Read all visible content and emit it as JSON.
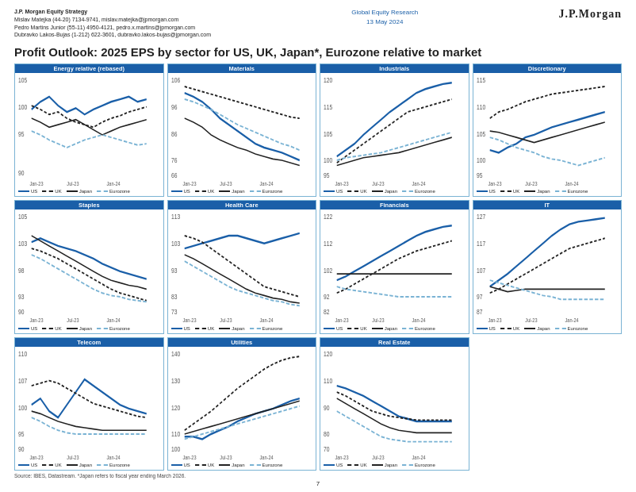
{
  "header": {
    "firm": "J.P. Morgan Equity Strategy",
    "authors": "Mislav Matejka (44-20) 7134-9741, mislav.matejka@jpmorgan.com\nPedro Martins Junior (55-11) 4950-4121, pedro.x.martins@jpmorgan.com\nDubravko Lakos-Bujas (1-212) 622-3601, dubravko.lakos-bujas@jpmorgan.com",
    "division": "Global Equity Research",
    "date": "13 May 2024",
    "logo": "J.P.Morgan"
  },
  "main_title": "Profit Outlook: 2025 EPS by sector for US, UK, Japan*, Eurozone relative to market",
  "charts": [
    {
      "title": "Energy relative (rebased)",
      "ymin": 90,
      "ymax": 105
    },
    {
      "title": "Materials",
      "ymin": 66,
      "ymax": 106
    },
    {
      "title": "Industrials",
      "ymin": 95,
      "ymax": 120
    },
    {
      "title": "Discretionary",
      "ymin": 95,
      "ymax": 115
    },
    {
      "title": "Staples",
      "ymin": 90,
      "ymax": 105
    },
    {
      "title": "Health Care",
      "ymin": 73,
      "ymax": 113
    },
    {
      "title": "Financials",
      "ymin": 82,
      "ymax": 122
    },
    {
      "title": "IT",
      "ymin": 87,
      "ymax": 127
    },
    {
      "title": "Telecom",
      "ymin": 90,
      "ymax": 110
    },
    {
      "title": "Utilities",
      "ymin": 100,
      "ymax": 140
    },
    {
      "title": "Real Estate",
      "ymin": 70,
      "ymax": 120
    },
    null
  ],
  "legend": {
    "us": {
      "label": "US",
      "color": "#1a5fa8",
      "dash": "solid"
    },
    "uk": {
      "label": "UK",
      "color": "#222",
      "dash": "dashed"
    },
    "japan": {
      "label": "Japan",
      "color": "#222",
      "dash": "solid"
    },
    "eurozone": {
      "label": "Eurozone",
      "color": "#7ab3d4",
      "dash": "dashed"
    }
  },
  "footer": "Source: IBES, Datastream. *Japan refers to fiscal year ending March 2026.",
  "page_number": "7"
}
